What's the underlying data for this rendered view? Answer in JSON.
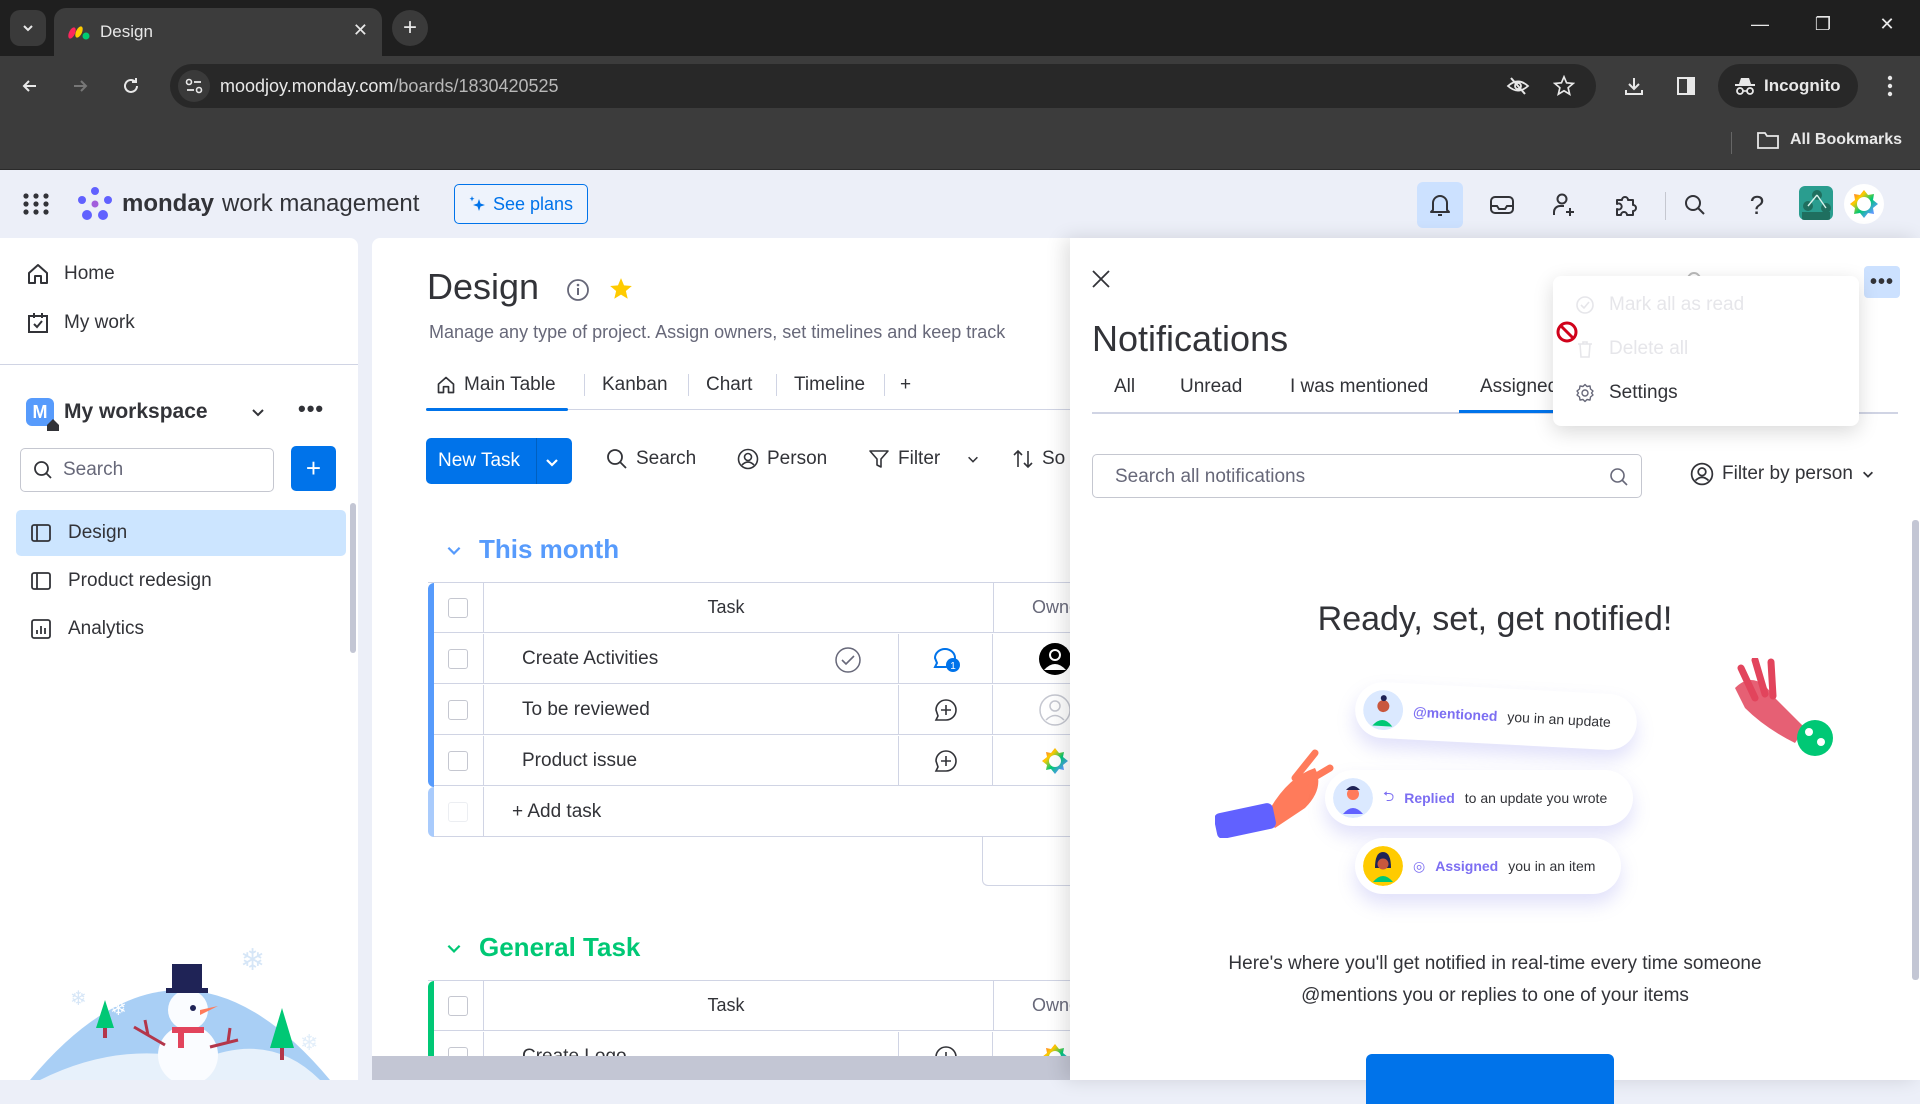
{
  "browser": {
    "tab_title": "Design",
    "url_host": "moodjoy.monday.com",
    "url_path": "/boards/1830420525",
    "incognito_label": "Incognito",
    "bookmarks_label": "All Bookmarks"
  },
  "app_header": {
    "brand": "monday",
    "product": "work management",
    "see_plans_label": "See plans",
    "icons": [
      "bell-icon",
      "inbox-icon",
      "invite-user-icon",
      "apps-puzzle-icon",
      "search-icon",
      "help-icon"
    ]
  },
  "sidebar": {
    "nav": [
      {
        "label": "Home",
        "icon": "home-icon"
      },
      {
        "label": "My work",
        "icon": "calendar-check-icon"
      }
    ],
    "workspace": {
      "badge": "M",
      "name": "My workspace"
    },
    "search_placeholder": "Search",
    "boards": [
      {
        "label": "Design",
        "icon": "board-icon",
        "active": true
      },
      {
        "label": "Product redesign",
        "icon": "board-icon",
        "active": false
      },
      {
        "label": "Analytics",
        "icon": "dashboard-icon",
        "active": false
      }
    ]
  },
  "board": {
    "title": "Design",
    "description": "Manage any type of project. Assign owners, set timelines and keep track",
    "views": [
      {
        "label": "Main Table",
        "active": true
      },
      {
        "label": "Kanban",
        "active": false
      },
      {
        "label": "Chart",
        "active": false
      },
      {
        "label": "Timeline",
        "active": false
      }
    ],
    "add_view_label": "+",
    "toolbar": {
      "new_task_label": "New Task",
      "search_label": "Search",
      "person_label": "Person",
      "filter_label": "Filter",
      "sort_label": "So"
    },
    "groups": [
      {
        "title": "This month",
        "color": "#579bfc",
        "task_header": "Task",
        "owner_header": "Owne",
        "rows": [
          {
            "name": "Create Activities",
            "updates": 1,
            "owner": "user-filled"
          },
          {
            "name": "To be reviewed",
            "updates": 0,
            "owner": "empty"
          },
          {
            "name": "Product issue",
            "updates": 0,
            "owner": "logo"
          }
        ],
        "add_task_label": "+ Add task"
      },
      {
        "title": "General Task",
        "color": "#00c875",
        "task_header": "Task",
        "owner_header": "Owne",
        "rows": [
          {
            "name": "Create Logo",
            "updates": 0,
            "owner": "logo"
          }
        ]
      }
    ]
  },
  "notifications": {
    "title": "Notifications",
    "tabs": [
      {
        "label": "All",
        "active": false
      },
      {
        "label": "Unread",
        "active": false
      },
      {
        "label": "I was mentioned",
        "active": false
      },
      {
        "label": "Assigned to me",
        "active": true
      }
    ],
    "search_placeholder": "Search all notifications",
    "filter_person_label": "Filter by person",
    "more_menu": {
      "items": [
        {
          "label": "Mark all as read",
          "icon": "check-circle-icon",
          "disabled": true
        },
        {
          "label": "Delete all",
          "icon": "trash-icon",
          "disabled": true
        },
        {
          "label": "Settings",
          "icon": "gear-icon",
          "disabled": false
        }
      ]
    },
    "empty_state": {
      "title": "Ready, set, get notified!",
      "cards": [
        {
          "keyword": "@mentioned",
          "text": "you in an update"
        },
        {
          "keyword": "Replied",
          "text": "to an update you wrote"
        },
        {
          "keyword": "Assigned",
          "text": "you in an item"
        }
      ],
      "description_line1": "Here's where you'll get notified in real-time every time someone",
      "description_line2": "@mentions you or replies to one of your items"
    },
    "accent_color": "#0073ea"
  }
}
